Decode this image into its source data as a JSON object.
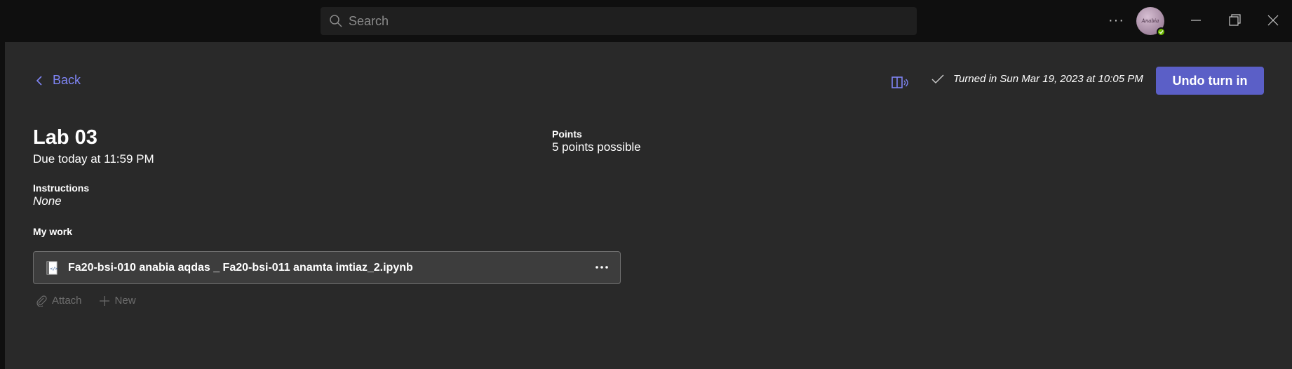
{
  "topbar": {
    "search_placeholder": "Search",
    "more_label": "···",
    "avatar_text": "Anabia",
    "presence": "available"
  },
  "header": {
    "back_label": "Back",
    "turned_in_text": "Turned in Sun Mar 19, 2023 at 10:05 PM",
    "undo_label": "Undo turn in"
  },
  "assignment": {
    "title": "Lab 03",
    "due": "Due today at 11:59 PM",
    "instructions_label": "Instructions",
    "instructions_value": "None",
    "points_label": "Points",
    "points_value": "5 points possible",
    "my_work_label": "My work",
    "file_name": "Fa20-bsi-010 anabia aqdas _ Fa20-bsi-011 anamta imtiaz_2.ipynb",
    "attach_label": "Attach",
    "new_label": "New"
  },
  "colors": {
    "accent": "#5b5fc7",
    "link": "#7f85f5",
    "background": "#292929",
    "titlebar": "#0f0f0f"
  }
}
